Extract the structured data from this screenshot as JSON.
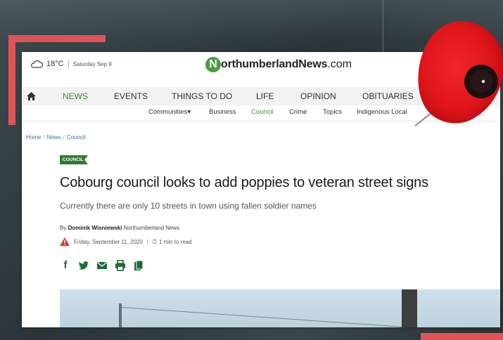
{
  "weather": {
    "temperature": "18°C",
    "date": "Saturday Sep 9"
  },
  "logo": {
    "letter": "N",
    "name": "orthumberlandNews",
    "tld": ".com"
  },
  "nav": {
    "primary": [
      "NEWS",
      "EVENTS",
      "THINGS TO DO",
      "LIFE",
      "OPINION",
      "OBITUARIES"
    ],
    "active_primary": "NEWS",
    "secondary": [
      "Communities▾",
      "Business",
      "Council",
      "Crime",
      "Topics",
      "Indigenous Local"
    ],
    "active_secondary": "Council"
  },
  "breadcrumb": [
    "Home",
    "News",
    "Council"
  ],
  "article": {
    "tag": "COUNCIL",
    "headline": "Cobourg council looks to add poppies to veteran street signs",
    "subheadline": "Currently there are only 10 streets in town using fallen soldier names",
    "byline_prefix": "By",
    "author": "Dominik Wisniewski",
    "publication": "Northumberland News",
    "published": "Friday, September 11, 2020",
    "read_time": "1 min to read"
  },
  "share_icons": [
    "facebook-icon",
    "twitter-icon",
    "email-icon",
    "print-icon",
    "copy-icon"
  ],
  "colors": {
    "accent_green": "#3a8a3c",
    "tag_green": "#2f7a35",
    "frame_red": "#e05356",
    "poppy_red": "#e8191c"
  }
}
